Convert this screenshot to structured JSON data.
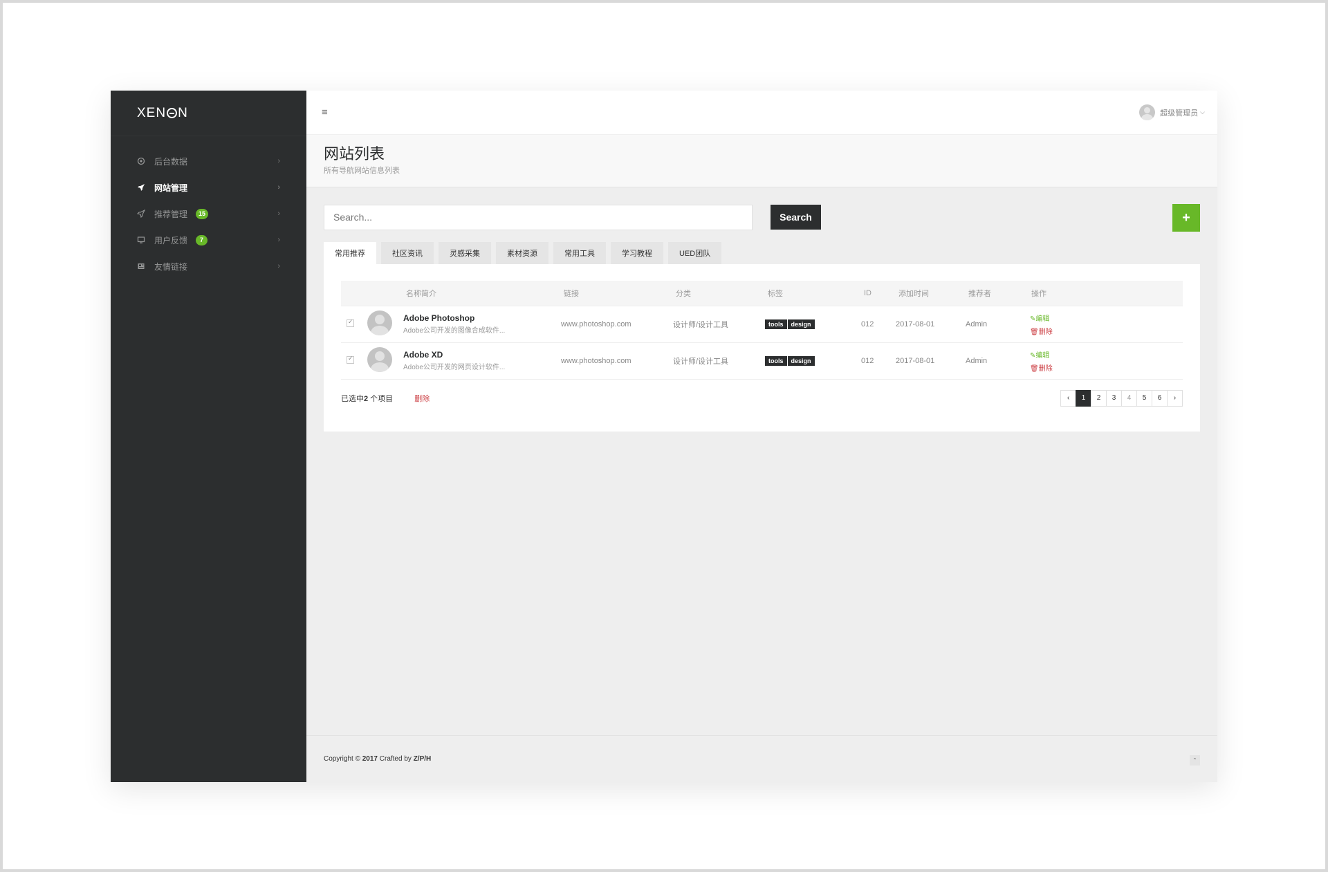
{
  "sidebar": {
    "logo": "XEN",
    "logo_tail": "N",
    "items": [
      {
        "label": "后台数据",
        "icon": "settings-icon",
        "badge": ""
      },
      {
        "label": "网站管理",
        "icon": "rocket-icon",
        "badge": "",
        "active": true
      },
      {
        "label": "推荐管理",
        "icon": "send-icon",
        "badge": "15"
      },
      {
        "label": "用户反馈",
        "icon": "monitor-icon",
        "badge": "7"
      },
      {
        "label": "友情链接",
        "icon": "newspaper-icon",
        "badge": ""
      }
    ]
  },
  "topbar": {
    "user_label": "超级管理员"
  },
  "header": {
    "title": "网站列表",
    "subtitle": "所有导航网站信息列表"
  },
  "search": {
    "placeholder": "Search...",
    "button_label": "Search",
    "add_label": "+"
  },
  "tabs": [
    "常用推荐",
    "社区资讯",
    "灵感采集",
    "素材资源",
    "常用工具",
    "学习教程",
    "UED团队"
  ],
  "table": {
    "headers": [
      "名称简介",
      "链接",
      "分类",
      "标签",
      "ID",
      "添加时间",
      "推荐者",
      "操作"
    ],
    "rows": [
      {
        "name": "Adobe Photoshop",
        "desc": "Adobe公司开发的图像合成软件...",
        "link": "www.photoshop.com",
        "category": "设计师/设计工具",
        "tags": [
          "tools",
          "design"
        ],
        "id": "012",
        "date": "2017-08-01",
        "author": "Admin",
        "edit": "编辑",
        "delete": "删除"
      },
      {
        "name": "Adobe XD",
        "desc": "Adobe公司开发的网页设计软件...",
        "link": "www.photoshop.com",
        "category": "设计师/设计工具",
        "tags": [
          "tools",
          "design"
        ],
        "id": "012",
        "date": "2017-08-01",
        "author": "Admin",
        "edit": "编辑",
        "delete": "删除"
      }
    ]
  },
  "selection": {
    "prefix": "已选中",
    "count": "2",
    "suffix": " 个项目",
    "delete_label": "删除"
  },
  "pagination": {
    "prev": "‹",
    "pages": [
      "1",
      "2",
      "3",
      "4",
      "5",
      "6"
    ],
    "next": "›",
    "current": "1"
  },
  "footer": {
    "prefix": "Copyright © ",
    "year": "2017",
    "middle": " Crafted by ",
    "author": "Z/P/H"
  },
  "colors": {
    "sidebar": "#2c2e2f",
    "accent": "#68b828",
    "danger": "#cc3f44"
  }
}
